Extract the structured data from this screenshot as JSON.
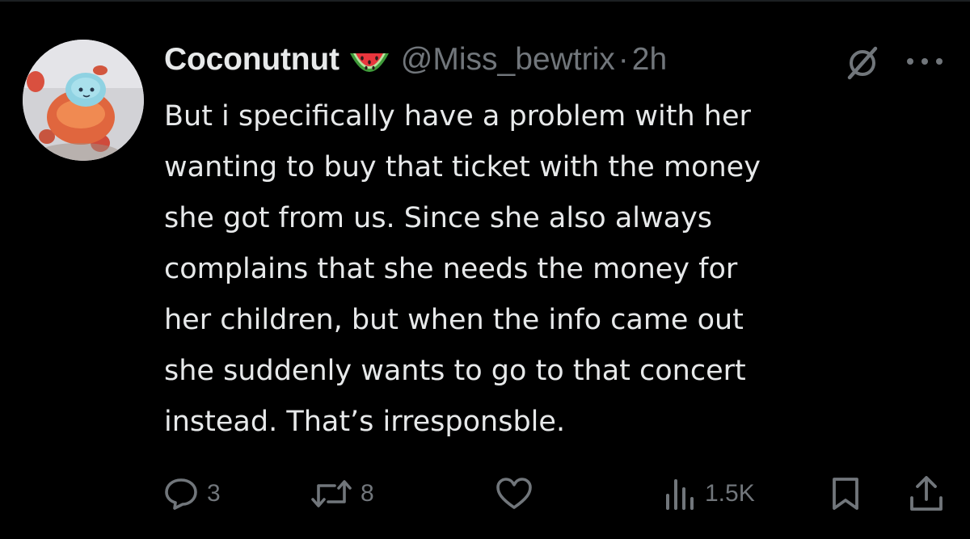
{
  "post": {
    "display_name": "Coconutnut",
    "handle": "@Miss_bewtrix",
    "separator": "·",
    "time": "2h",
    "body_lines": [
      "But i specifically have a problem with her",
      "wanting to buy that ticket with the money",
      "she got from us. Since she also always",
      "complains that she needs the money for",
      "her children, but when the info came out",
      "she suddenly wants to go to that concert",
      "instead. That’s irresponsble."
    ]
  },
  "actions": {
    "reply_count": "3",
    "retweet_count": "8",
    "like_count": "",
    "views_count": "1.5K"
  },
  "icons": {
    "name_emoji": "watermelon-icon",
    "mute": "mute-icon",
    "more": "more-icon",
    "reply": "reply-icon",
    "retweet": "retweet-icon",
    "like": "heart-icon",
    "views": "views-icon",
    "bookmark": "bookmark-icon",
    "share": "share-icon"
  },
  "colors": {
    "background": "#000000",
    "primary_text": "#e7e9ea",
    "secondary_text": "#71767b"
  }
}
